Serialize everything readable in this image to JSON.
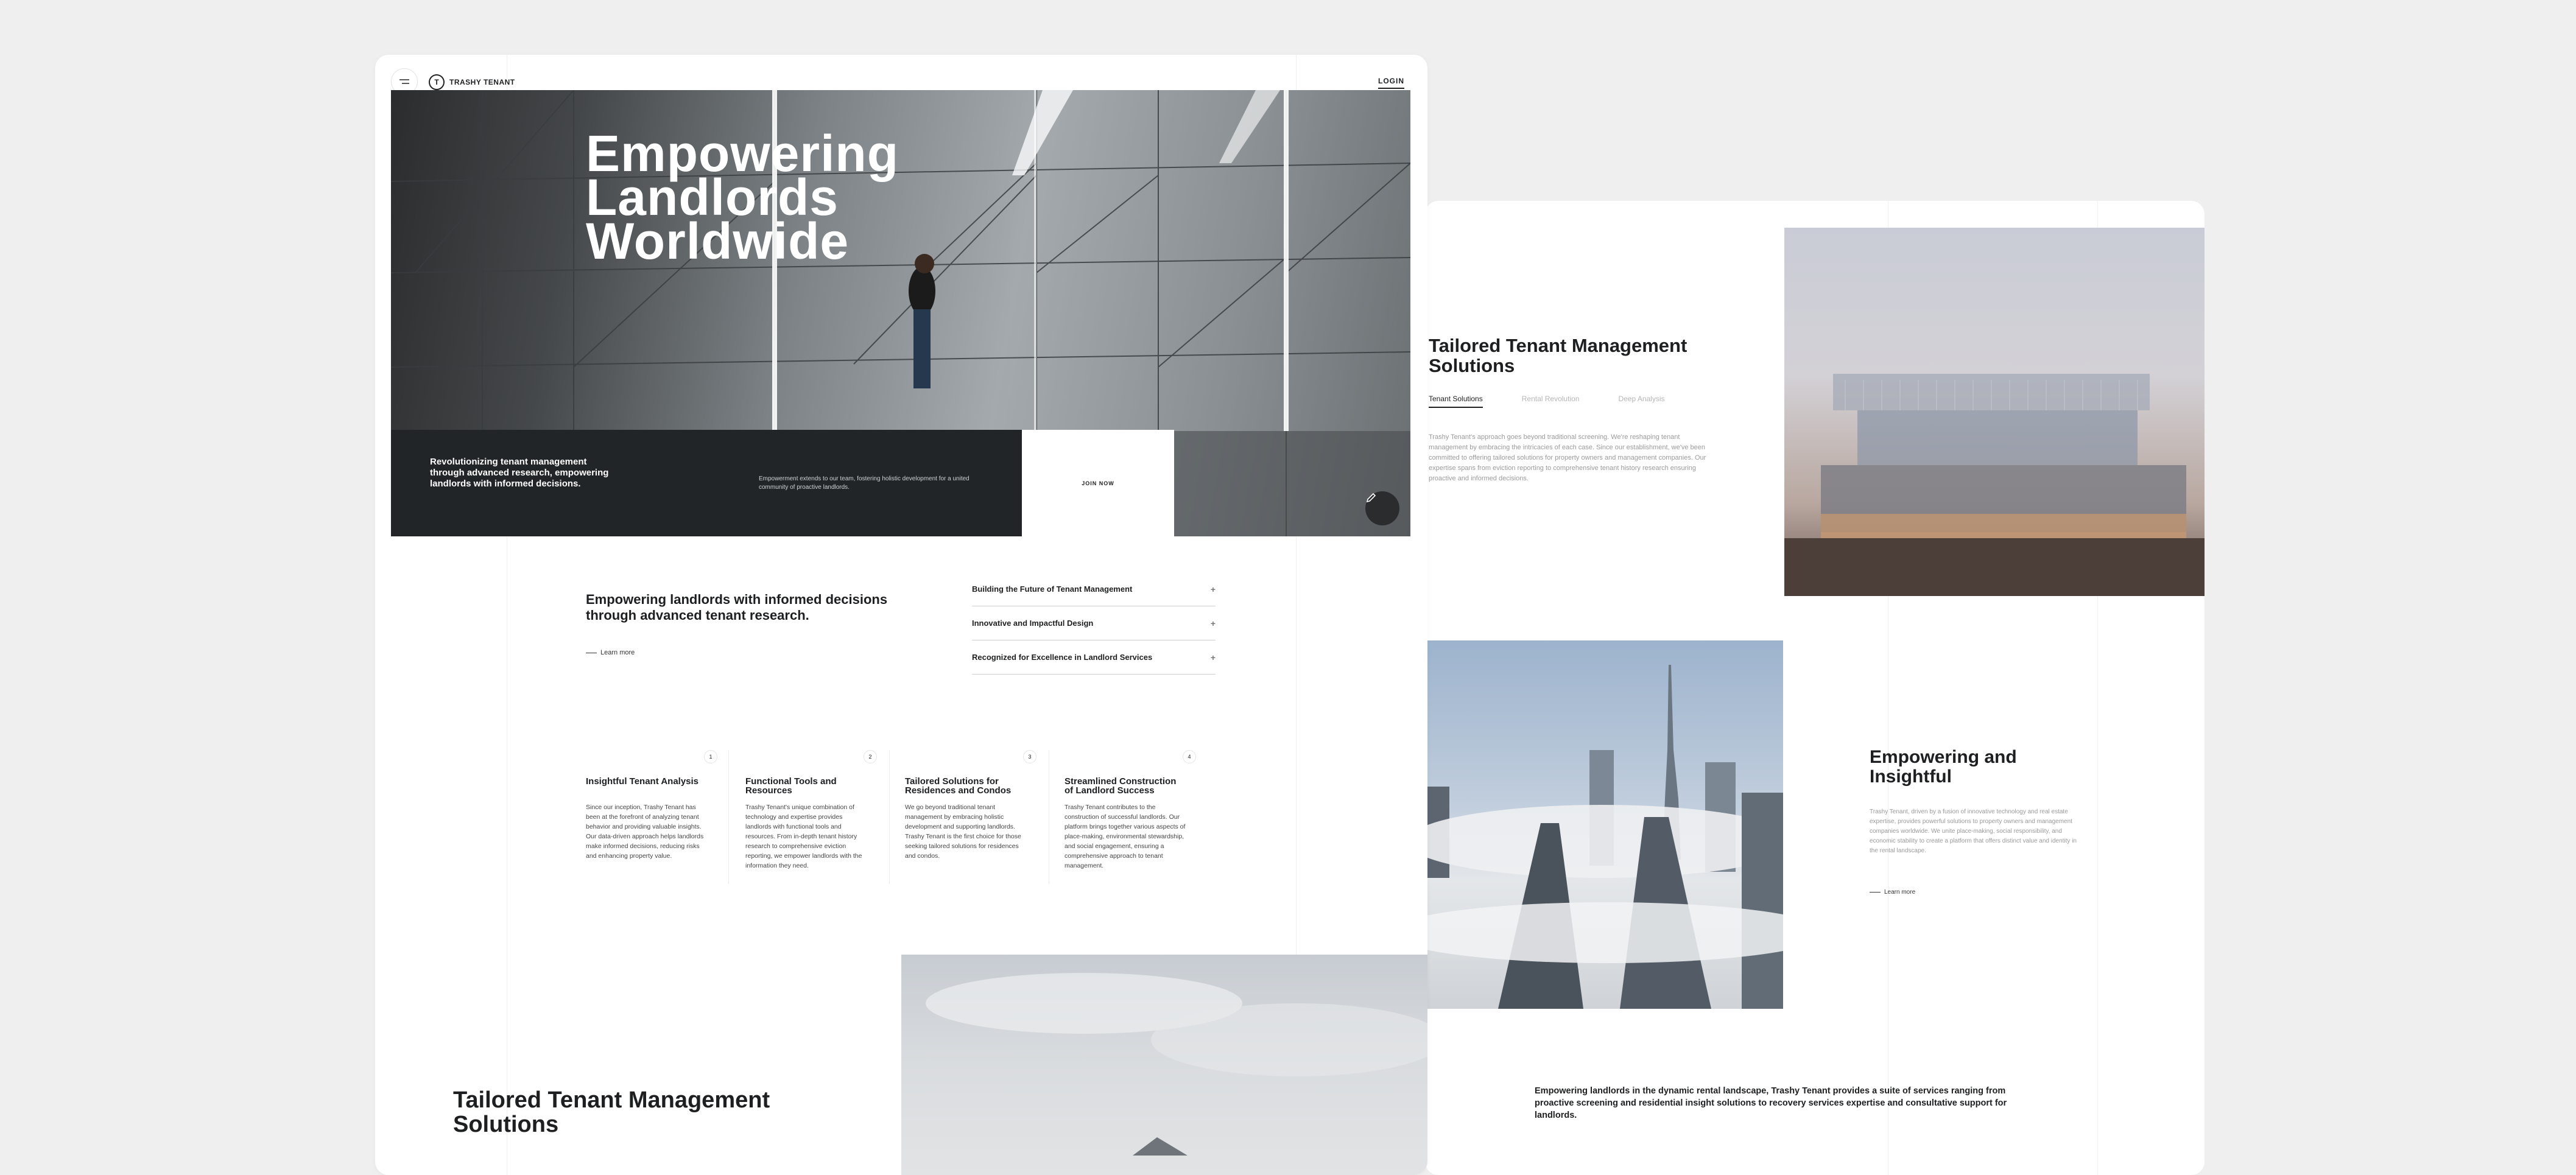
{
  "header": {
    "brand": "TRASHY TENANT",
    "menu_icon": "menu-icon",
    "logo_icon": "logo-mark-icon",
    "login": "LOGIN"
  },
  "hero": {
    "title_line1": "Empowering",
    "title_line2": "Landlords",
    "title_line3": "Worldwide",
    "tagline": "Revolutionizing tenant management through advanced research, empowering landlords with informed decisions.",
    "description": "Empowerment extends to our team, fostering holistic development for a united community of proactive landlords.",
    "join_label": "JOIN NOW",
    "edit_icon": "pencil-icon"
  },
  "intro": {
    "heading": "Empowering landlords with informed decisions through advanced tenant research.",
    "learn_more": "Learn more"
  },
  "accordion": [
    {
      "label": "Building the Future of Tenant Management"
    },
    {
      "label": "Innovative and Impactful Design"
    },
    {
      "label": "Recognized for Excellence in Landlord Services"
    }
  ],
  "features": [
    {
      "num": "1",
      "title": "Insightful Tenant Analysis",
      "body": "Since our inception, Trashy Tenant has been at the forefront of analyzing tenant behavior and providing valuable insights. Our data-driven approach helps landlords make informed decisions, reducing risks and enhancing property value."
    },
    {
      "num": "2",
      "title": "Functional Tools and Resources",
      "body": "Trashy Tenant's unique combination of technology and expertise provides landlords with functional tools and resources. From in-depth tenant history research to comprehensive eviction reporting, we empower landlords with the information they need."
    },
    {
      "num": "3",
      "title": "Tailored Solutions for Residences and Condos",
      "body": "We go beyond traditional tenant management by embracing holistic development and supporting landlords. Trashy Tenant is the first choice for those seeking tailored solutions for residences and condos."
    },
    {
      "num": "4",
      "title": "Streamlined Construction of Landlord Success",
      "body": "Trashy Tenant contributes to the construction of successful landlords. Our platform brings together various aspects of place-making, environmental stewardship, and social engagement, ensuring a comprehensive approach to tenant management."
    }
  ],
  "bottom_section": {
    "title_line1": "Tailored Tenant Management",
    "title_line2": "Solutions"
  },
  "page2": {
    "section1": {
      "title_line1": "Tailored Tenant Management",
      "title_line2": "Solutions",
      "tabs": [
        "Tenant Solutions",
        "Rental Revolution",
        "Deep Analysis"
      ],
      "active_tab": "Tenant Solutions",
      "body": "Trashy Tenant's approach goes beyond traditional screening. We're reshaping tenant management by embracing the intricacies of each case. Since our establishment, we've been committed to offering tailored solutions for property owners and management companies. Our expertise spans from eviction reporting to comprehensive tenant history research ensuring proactive and informed decisions."
    },
    "section2": {
      "title_line1": "Empowering and",
      "title_line2": "Insightful",
      "body": "Trashy Tenant, driven by a fusion of innovative technology and real estate expertise, provides powerful solutions to property owners and management companies worldwide. We unite place-making, social responsibility, and economic stability to create a platform that offers distinct value and identity in the rental landscape.",
      "learn_more": "Learn more"
    },
    "footer_text": "Empowering landlords in the dynamic rental landscape, Trashy Tenant provides a suite of services ranging from proactive screening and residential insight solutions to recovery services expertise and consultative support for landlords."
  }
}
